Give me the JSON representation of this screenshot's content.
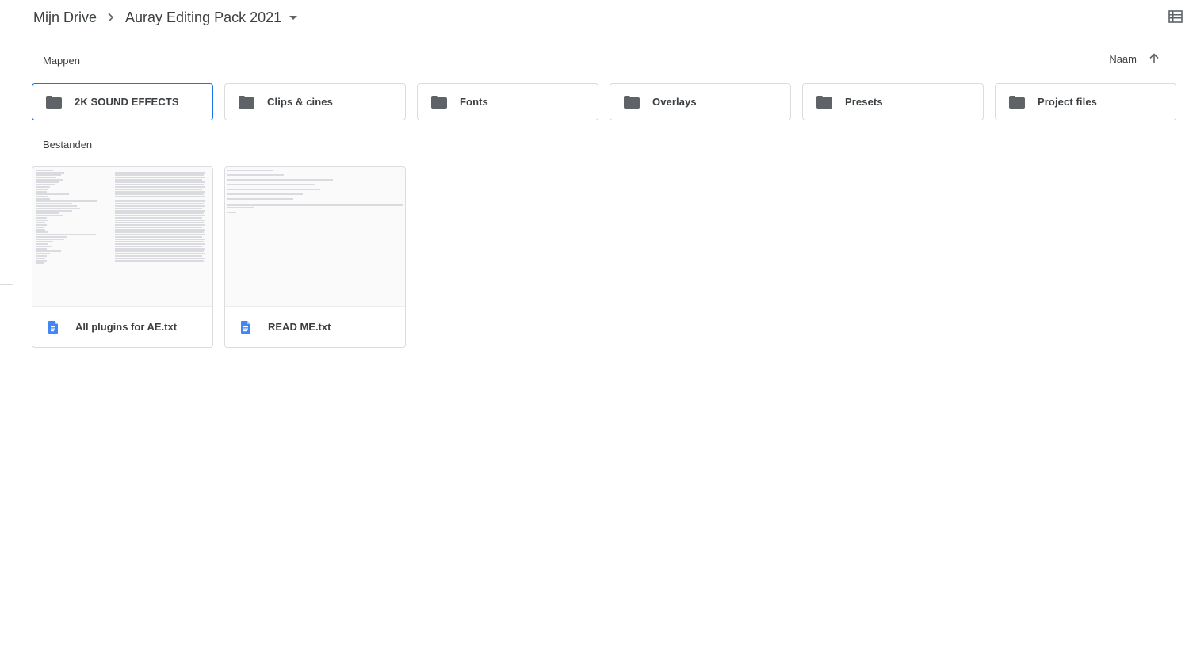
{
  "breadcrumb": {
    "root": "Mijn Drive",
    "current": "Auray Editing Pack 2021"
  },
  "sections": {
    "folders_title": "Mappen",
    "files_title": "Bestanden"
  },
  "sort": {
    "label": "Naam",
    "direction": "ascending"
  },
  "folders": [
    {
      "name": "2K SOUND EFFECTS",
      "selected": true
    },
    {
      "name": "Clips & cines",
      "selected": false
    },
    {
      "name": "Fonts",
      "selected": false
    },
    {
      "name": "Overlays",
      "selected": false
    },
    {
      "name": "Presets",
      "selected": false
    },
    {
      "name": "Project files",
      "selected": false
    }
  ],
  "files": [
    {
      "name": "All plugins for AE.txt",
      "icon": "google-docs-icon"
    },
    {
      "name": "READ ME.txt",
      "icon": "google-docs-icon"
    }
  ],
  "colors": {
    "accent": "#1a73e8",
    "folder_icon": "#5f6368",
    "doc_icon": "#4285f4",
    "border": "#dadce0"
  }
}
